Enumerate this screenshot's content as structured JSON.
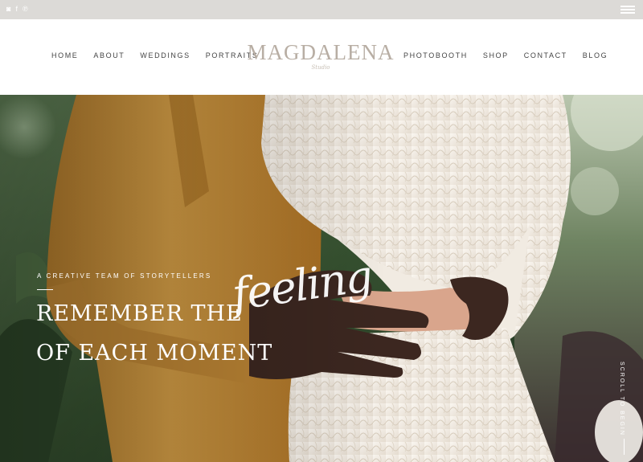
{
  "topbar": {
    "social_icons": [
      {
        "name": "instagram-icon",
        "glyph": "◙"
      },
      {
        "name": "facebook-icon",
        "glyph": "f"
      },
      {
        "name": "pinterest-icon",
        "glyph": "℗"
      }
    ],
    "menu_icon": "hamburger-menu-icon"
  },
  "header": {
    "nav_left": [
      "HOME",
      "ABOUT",
      "WEDDINGS",
      "PORTRAITS"
    ],
    "logo": {
      "main": "MAGDALENA",
      "sub": "Studio"
    },
    "nav_right": [
      "PHOTOBOOTH",
      "SHOP",
      "CONTACT",
      "BLOG"
    ]
  },
  "hero": {
    "kicker": "A CREATIVE TEAM OF STORYTELLERS",
    "headline_line1": "REMEMBER THE",
    "headline_script": "feeling",
    "headline_line2": "OF EACH MOMENT",
    "scroll_label": "SCROLL TO BEGIN",
    "image": "couple-embracing-photo"
  },
  "colors": {
    "topbar_bg": "#dcdad7",
    "logo": "#b8aea4",
    "nav_text": "#444444",
    "jacket": "#c7923c",
    "dress": "#f2ece4",
    "foliage": "#3d5a36"
  }
}
